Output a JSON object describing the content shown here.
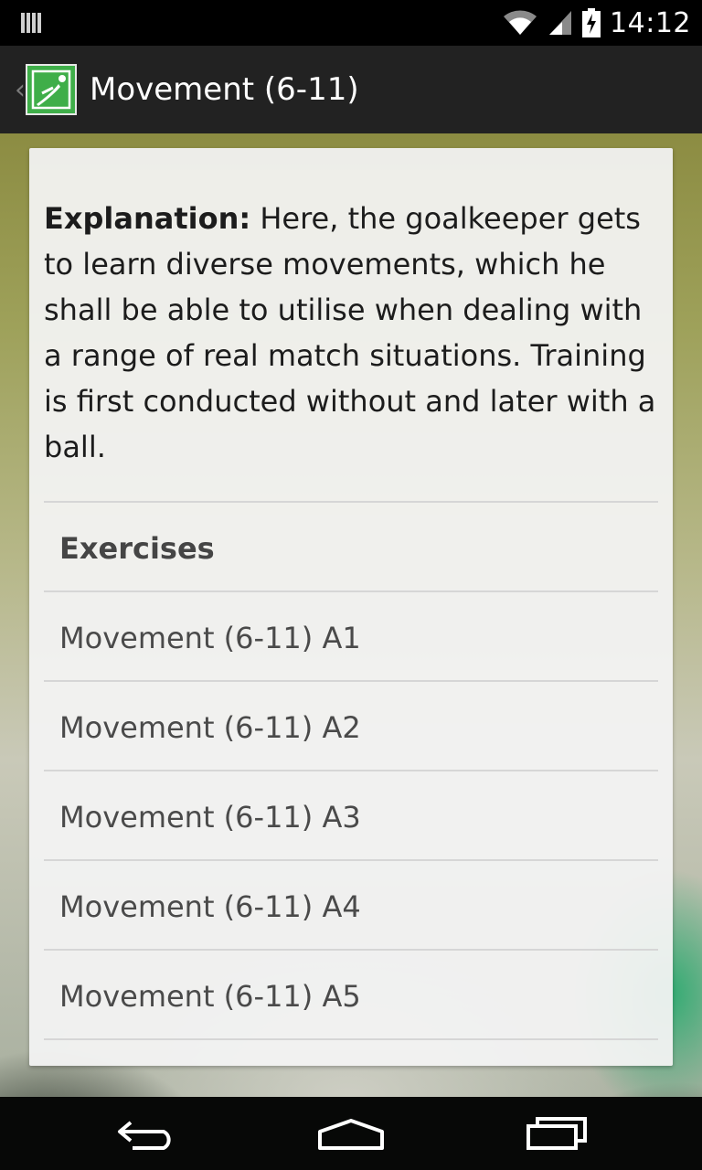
{
  "status_bar": {
    "time": "14:12",
    "icons": [
      "notification-icon",
      "wifi-icon",
      "signal-icon",
      "battery-charging-icon"
    ]
  },
  "action_bar": {
    "title": "Movement (6-11)",
    "up_icon": "chevron-left-icon",
    "logo_icon": "goalkeeper-logo-icon",
    "logo_color": "#3fae49"
  },
  "content": {
    "explanation_label": "Explanation:",
    "explanation_text": " Here, the goalkeeper gets to learn diverse movements, which he shall be able to utilise when dealing with a range of real match situations. Training is first conducted without and later with a ball.",
    "exercises_header": "Exercises",
    "exercises": [
      "Movement (6-11) A1",
      "Movement (6-11) A2",
      "Movement (6-11) A3",
      "Movement (6-11) A4",
      "Movement (6-11) A5"
    ]
  },
  "nav_bar": {
    "icons": [
      "back-icon",
      "home-icon",
      "recents-icon"
    ]
  }
}
